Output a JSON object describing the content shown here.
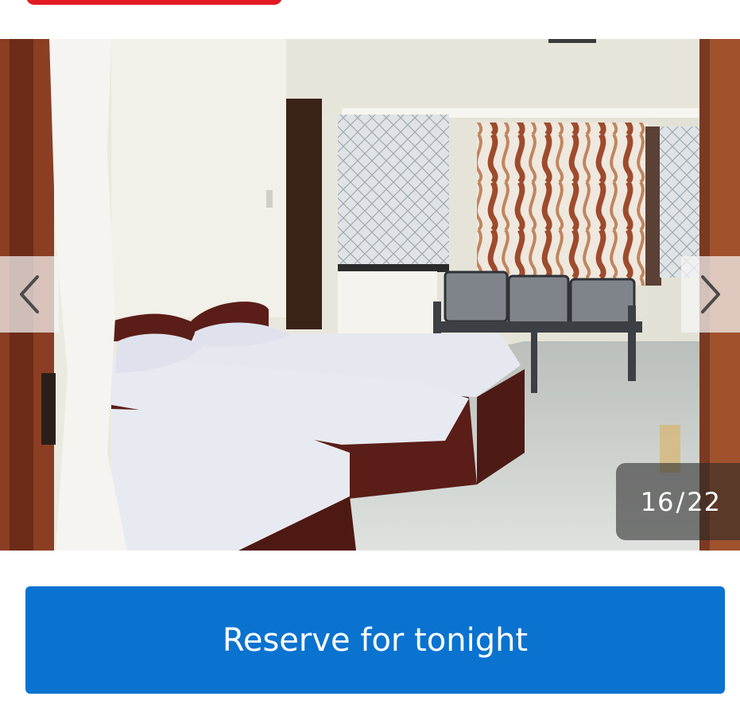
{
  "gallery": {
    "current_index": "16",
    "separator": "/",
    "total_count": "22",
    "prev_icon": "chevron-left-icon",
    "next_icon": "chevron-right-icon"
  },
  "actions": {
    "reserve_label": "Reserve for tonight"
  },
  "colors": {
    "brand_red": "#e21b22",
    "primary_blue": "#0a73d0"
  }
}
